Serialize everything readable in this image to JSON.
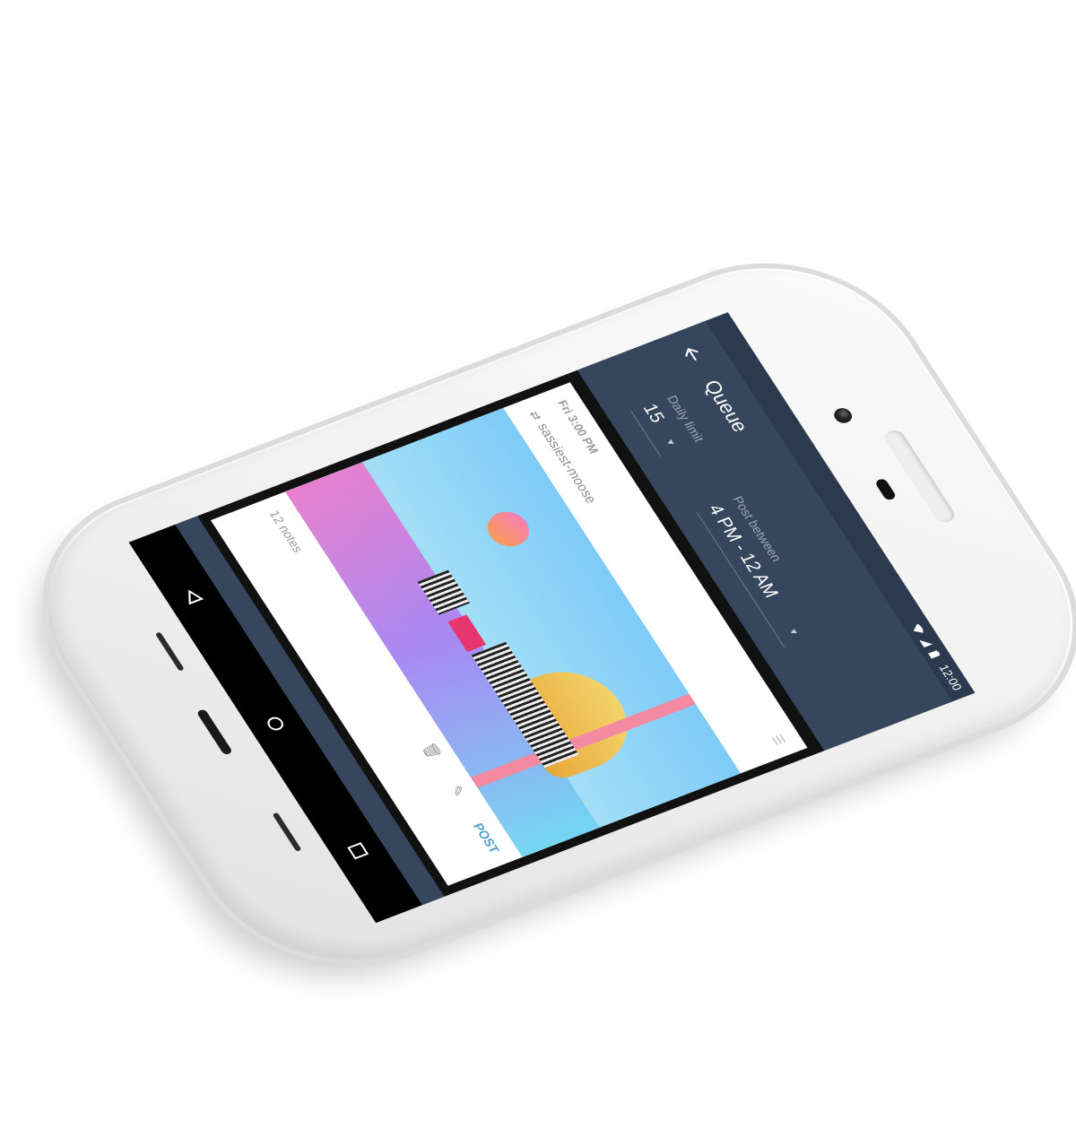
{
  "statusbar": {
    "time": "12:00"
  },
  "appbar": {
    "title": "Queue",
    "daily_limit_label": "Daily limit",
    "daily_limit_value": "15",
    "post_between_label": "Post between",
    "post_between_value": "4 PM - 12 AM"
  },
  "post": {
    "time": "Fri 3:00 PM",
    "blog": "sassiest-moose",
    "notes": "12 notes",
    "post_button": "POST"
  },
  "colors": {
    "appbar": "#36465d",
    "statusbar": "#2c3a4f",
    "accent": "#529ecc"
  },
  "icons": {
    "back": "arrow-left",
    "reblog": "reblog",
    "drag": "drag-handle",
    "delete": "trash",
    "edit": "pencil",
    "nav_back": "triangle",
    "nav_home": "circle",
    "nav_recents": "square"
  }
}
